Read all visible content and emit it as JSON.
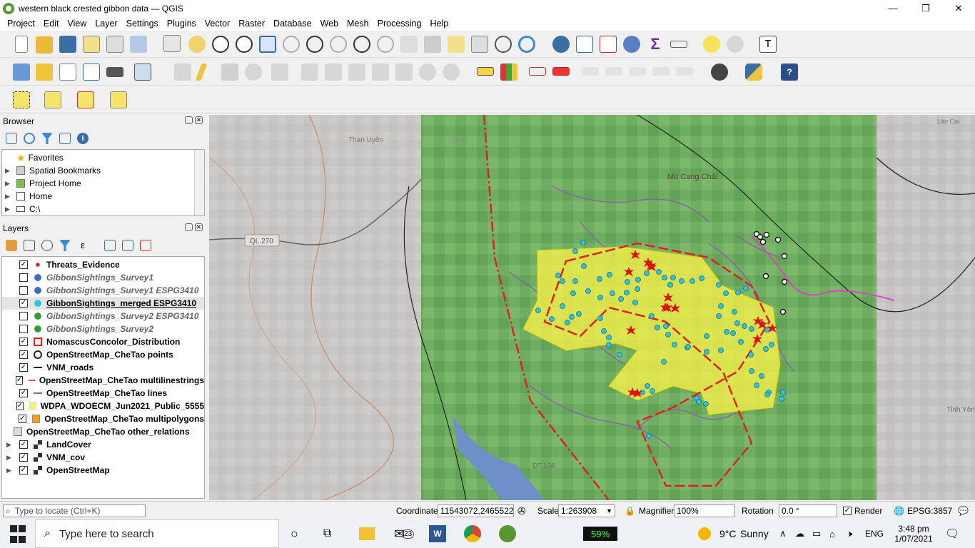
{
  "window": {
    "title": "western black crested gibbon data — QGIS",
    "minimize": "—",
    "maximize": "❐",
    "close": "✕"
  },
  "menu": [
    "Project",
    "Edit",
    "View",
    "Layer",
    "Settings",
    "Plugins",
    "Vector",
    "Raster",
    "Database",
    "Web",
    "Mesh",
    "Processing",
    "Help"
  ],
  "browser": {
    "title": "Browser",
    "items": [
      "Favorites",
      "Spatial Bookmarks",
      "Project Home",
      "Home",
      "C:\\"
    ]
  },
  "layers_panel": {
    "title": "Layers",
    "layers": [
      {
        "name": "Threats_Evidence",
        "checked": true,
        "style": "b",
        "symbol": "red-dot"
      },
      {
        "name": "GibbonSightings_Survey1",
        "checked": false,
        "style": "it",
        "symbol": "blue-dot"
      },
      {
        "name": "GibbonSightings_Survey1 ESPG3410",
        "checked": false,
        "style": "it",
        "symbol": "blue-dot"
      },
      {
        "name": "GibbonSightings_merged ESPG3410",
        "checked": true,
        "style": "b",
        "symbol": "cyan-dot",
        "selected": true
      },
      {
        "name": "GibbonSightings_Survey2 ESPG3410",
        "checked": false,
        "style": "it",
        "symbol": "green-dot"
      },
      {
        "name": "GibbonSightings_Survey2",
        "checked": false,
        "style": "it",
        "symbol": "green-dot"
      },
      {
        "name": "NomascusConcolor_Distribution",
        "checked": true,
        "style": "b",
        "symbol": "red-dash-box"
      },
      {
        "name": "OpenStreetMap_CheTao points",
        "checked": true,
        "style": "b",
        "symbol": "white-circle"
      },
      {
        "name": "VNM_roads",
        "checked": true,
        "style": "b",
        "symbol": "black-line"
      },
      {
        "name": "OpenStreetMap_CheTao multilinestrings",
        "checked": true,
        "style": "b",
        "symbol": "magenta-line"
      },
      {
        "name": "OpenStreetMap_CheTao lines",
        "checked": true,
        "style": "b",
        "symbol": "purple-line"
      },
      {
        "name": "WDPA_WDOECM_Jun2021_Public_5555",
        "checked": true,
        "style": "b",
        "symbol": "yellow-box"
      },
      {
        "name": "OpenStreetMap_CheTao multipolygons",
        "checked": true,
        "style": "b",
        "symbol": "orange-box"
      },
      {
        "name": "OpenStreetMap_CheTao other_relations",
        "checked": null,
        "style": "b",
        "symbol": "table"
      },
      {
        "name": "LandCover",
        "checked": true,
        "style": "b",
        "symbol": "raster"
      },
      {
        "name": "VNM_cov",
        "checked": true,
        "style": "b",
        "symbol": "raster"
      },
      {
        "name": "OpenStreetMap",
        "checked": true,
        "style": "b",
        "symbol": "raster"
      }
    ]
  },
  "map_labels": {
    "than_uyen": "Than Uyên",
    "road_ql270": "QL.270",
    "mu_cang_chai": "Mù Cang Chải",
    "dt": "DT.106",
    "tinh_yen": "Tỉnh Yên",
    "lao_cai": "Lào Cai",
    "ql32": "QL32"
  },
  "status": {
    "locate_placeholder": "Type to locate (Ctrl+K)",
    "coordinate_label": "Coordinate",
    "coordinate": "11543072,2465522",
    "scale_label": "Scale",
    "scale": "1:263908",
    "magnifier_label": "Magnifier",
    "magnifier": "100%",
    "rotation_label": "Rotation",
    "rotation": "0.0 °",
    "render_label": "Render",
    "crs": "EPSG:3857"
  },
  "taskbar": {
    "search": "Type here to search",
    "mail_count": "23",
    "battery": "59%",
    "temp": "9°C",
    "weather": "Sunny",
    "lang": "ENG",
    "time": "3:48 pm",
    "date": "1/07/2021"
  }
}
